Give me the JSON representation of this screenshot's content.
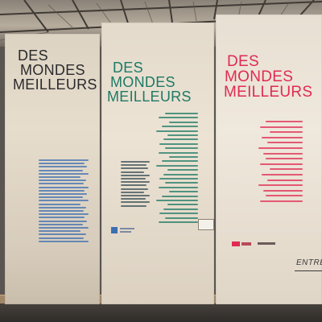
{
  "exhibition": {
    "panels": [
      {
        "title_lines": [
          "DES",
          "MONDES",
          "MEILLEURS"
        ],
        "color": "#2a2a2c"
      },
      {
        "title_lines": [
          "DES",
          "MONDES",
          "MEILLEURS"
        ],
        "color": "#1e7a66"
      },
      {
        "title_lines": [
          "DES",
          "MONDES",
          "MEILLEURS"
        ],
        "color": "#e02a52"
      }
    ],
    "entrance_sign": "ENTRÉ",
    "colors": {
      "panel": "#e3dacb",
      "body_text_blue": "#3d6fb0",
      "names_green": "#1e7a66",
      "names_red": "#e02a52"
    }
  }
}
